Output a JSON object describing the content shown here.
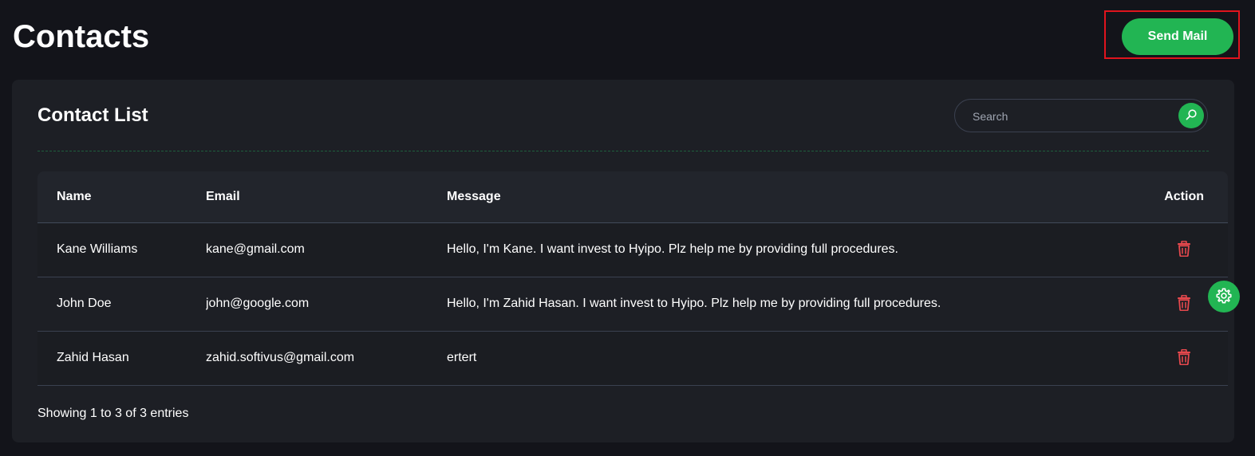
{
  "page": {
    "title": "Contacts",
    "send_mail_label": "Send Mail"
  },
  "card": {
    "title": "Contact List",
    "search_placeholder": "Search",
    "search_value": ""
  },
  "table": {
    "columns": [
      "Name",
      "Email",
      "Message",
      "Action"
    ],
    "rows": [
      {
        "name": "Kane Williams",
        "email": "kane@gmail.com",
        "message": "Hello, I'm Kane. I want invest to Hyipo. Plz help me by providing full procedures.",
        "action_icon": "trash-icon"
      },
      {
        "name": "John Doe",
        "email": "john@google.com",
        "message": "Hello, I'm Zahid Hasan. I want invest to Hyipo. Plz help me by providing full procedures.",
        "action_icon": "trash-icon"
      },
      {
        "name": "Zahid Hasan",
        "email": "zahid.softivus@gmail.com",
        "message": "ertert",
        "action_icon": "trash-icon"
      }
    ]
  },
  "footer": {
    "info": "Showing 1 to 3 of 3 entries"
  },
  "icons": {
    "search": "search-icon",
    "delete": "trash-icon",
    "settings": "gear-icon"
  },
  "colors": {
    "accent": "#22b553",
    "danger": "#e5484d",
    "highlight_border": "#e0141d",
    "background": "#13141a",
    "card": "#1d1f25"
  }
}
